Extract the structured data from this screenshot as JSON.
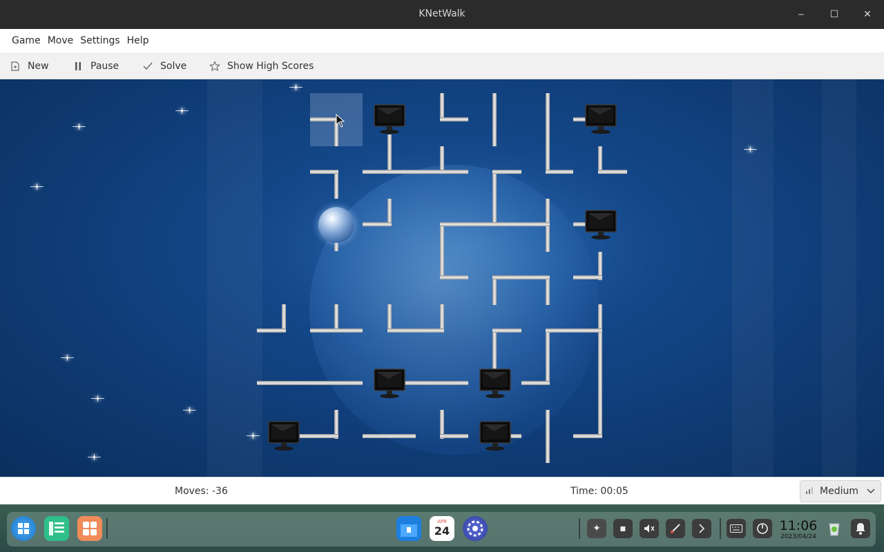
{
  "window": {
    "title": "KNetWalk",
    "minimize": "‒",
    "maximize": "☐",
    "close": "✕"
  },
  "menu": [
    "Game",
    "Move",
    "Settings",
    "Help"
  ],
  "toolbar": {
    "new_label": "New",
    "pause_label": "Pause",
    "solve_label": "Solve",
    "high_scores_label": "Show High Scores"
  },
  "status": {
    "moves": "Moves: -36",
    "time": "Time: 00:05",
    "difficulty": "Medium"
  },
  "taskbar": {
    "calendar_day": "24",
    "calendar_month": "APR",
    "clock_time": "11:06",
    "clock_date": "2023/04/24"
  }
}
